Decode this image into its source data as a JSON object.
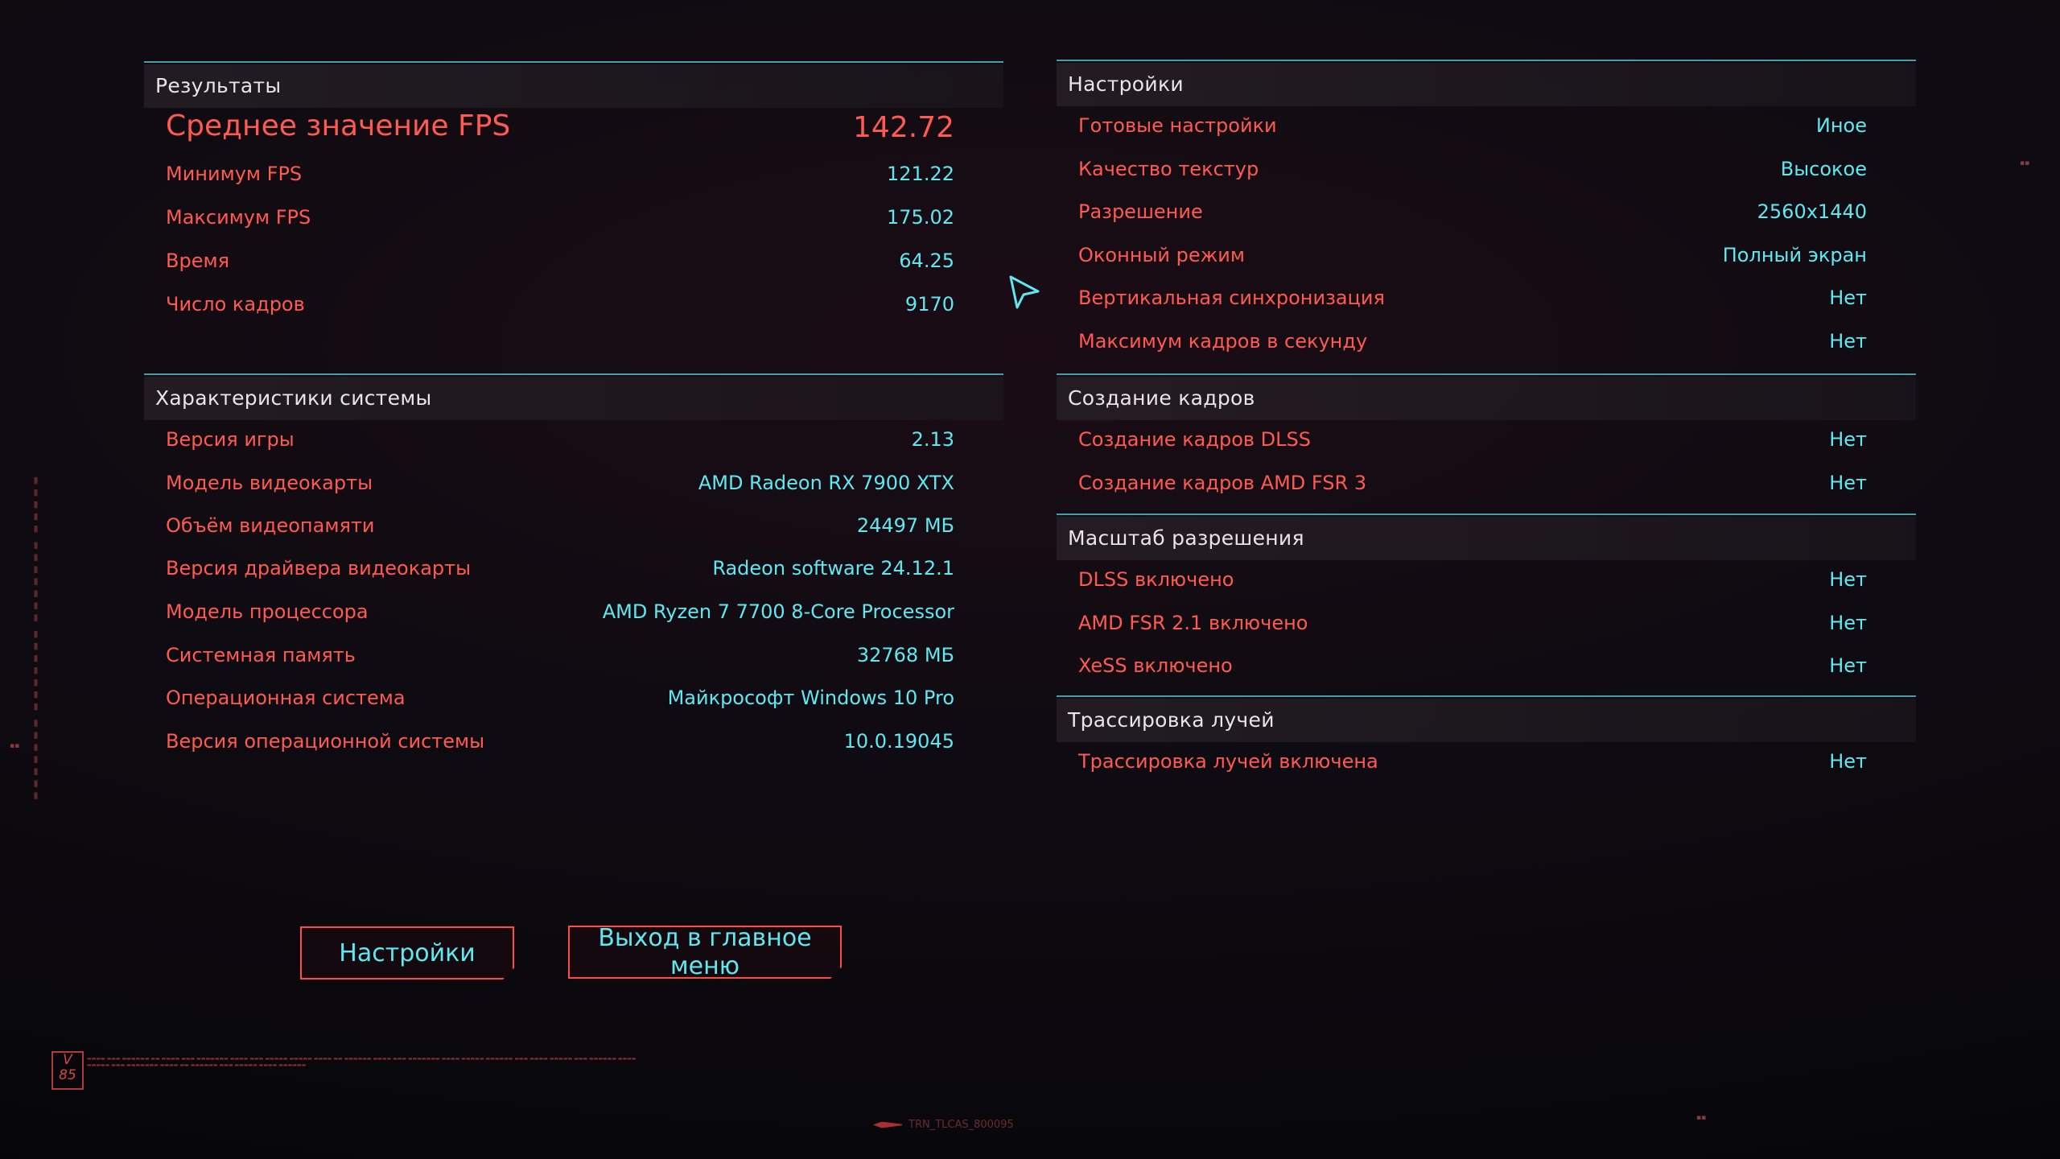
{
  "results": {
    "title": "Результаты",
    "avg_fps": {
      "label": "Среднее значение FPS",
      "value": "142.72"
    },
    "rows": [
      {
        "label": "Минимум FPS",
        "value": "121.22"
      },
      {
        "label": "Максимум FPS",
        "value": "175.02"
      },
      {
        "label": "Время",
        "value": "64.25"
      },
      {
        "label": "Число кадров",
        "value": "9170"
      }
    ]
  },
  "system": {
    "title": "Характеристики системы",
    "rows": [
      {
        "label": "Версия игры",
        "value": "2.13"
      },
      {
        "label": "Модель видеокарты",
        "value": "AMD Radeon RX 7900 XTX"
      },
      {
        "label": "Объём видеопамяти",
        "value": "24497 МБ"
      },
      {
        "label": "Версия драйвера видеокарты",
        "value": "Radeon software 24.12.1"
      },
      {
        "label": "Модель процессора",
        "value": "AMD Ryzen 7 7700 8-Core Processor"
      },
      {
        "label": "Системная память",
        "value": "32768 МБ"
      },
      {
        "label": "Операционная система",
        "value": "Майкрософт Windows 10 Pro"
      },
      {
        "label": "Версия операционной системы",
        "value": "10.0.19045"
      }
    ]
  },
  "settings": {
    "title": "Настройки",
    "rows": [
      {
        "label": "Готовые настройки",
        "value": "Иное"
      },
      {
        "label": "Качество текстур",
        "value": "Высокое"
      },
      {
        "label": "Разрешение",
        "value": "2560x1440"
      },
      {
        "label": "Оконный режим",
        "value": "Полный экран"
      },
      {
        "label": "Вертикальная синхронизация",
        "value": "Нет"
      },
      {
        "label": "Максимум кадров в секунду",
        "value": "Нет"
      }
    ]
  },
  "framegen": {
    "title": "Создание кадров",
    "rows": [
      {
        "label": "Создание кадров DLSS",
        "value": "Нет"
      },
      {
        "label": "Создание кадров AMD FSR 3",
        "value": "Нет"
      }
    ]
  },
  "scaling": {
    "title": "Масштаб разрешения",
    "rows": [
      {
        "label": "DLSS включено",
        "value": "Нет"
      },
      {
        "label": "AMD FSR 2.1 включено",
        "value": "Нет"
      },
      {
        "label": "XeSS включено",
        "value": "Нет"
      }
    ]
  },
  "raytracing": {
    "title": "Трассировка лучей",
    "rows": [
      {
        "label": "Трассировка лучей включена",
        "value": "Нет"
      }
    ]
  },
  "buttons": {
    "settings_label": "Настройки",
    "exit_label": "Выход в главное меню"
  },
  "decor": {
    "logo_text": "V 85",
    "footer_tag": "TRN_TLCAS_800095"
  },
  "colors": {
    "label_red": "#ff5a52",
    "value_cyan": "#5fe8f0",
    "divider_teal": "#4fb9c4",
    "header_text": "#e7e5e7"
  }
}
